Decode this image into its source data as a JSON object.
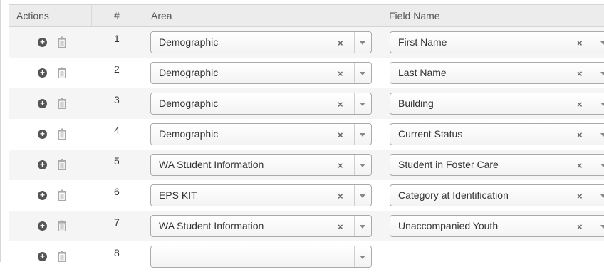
{
  "headers": {
    "actions": "Actions",
    "number": "#",
    "area": "Area",
    "field_name": "Field Name"
  },
  "icons": {
    "add": "plus-circle-icon",
    "delete": "trash-icon",
    "clear": "clear-x-icon",
    "dropdown": "chevron-down-icon"
  },
  "clear_glyph": "×",
  "plus_glyph": "+",
  "rows": [
    {
      "num": "1",
      "area": "Demographic",
      "field": "First Name"
    },
    {
      "num": "2",
      "area": "Demographic",
      "field": "Last Name"
    },
    {
      "num": "3",
      "area": "Demographic",
      "field": "Building"
    },
    {
      "num": "4",
      "area": "Demographic",
      "field": "Current Status"
    },
    {
      "num": "5",
      "area": "WA Student Information",
      "field": "Student in Foster Care"
    },
    {
      "num": "6",
      "area": "EPS KIT",
      "field": "Category at Identification"
    },
    {
      "num": "7",
      "area": "WA Student Information",
      "field": "Unaccompanied Youth"
    },
    {
      "num": "8",
      "area": "",
      "field": null
    }
  ]
}
